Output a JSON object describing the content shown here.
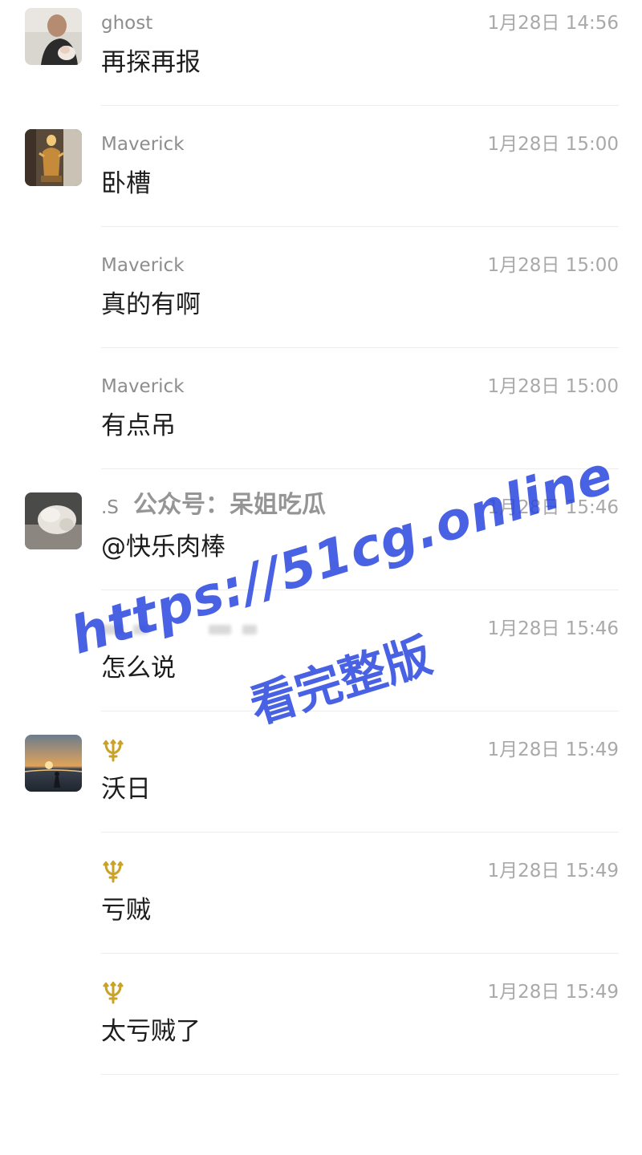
{
  "messages": [
    {
      "sender": "ghost",
      "time": "1月28日 14:56",
      "text": "再探再报",
      "avatar": "avatar-man-with-baby"
    },
    {
      "sender": "Maverick",
      "time": "1月28日 15:00",
      "text": "卧槽",
      "avatar": "avatar-golden-figure"
    },
    {
      "sender": "Maverick",
      "time": "1月28日 15:00",
      "text": "真的有啊"
    },
    {
      "sender": "Maverick",
      "time": "1月28日 15:00",
      "text": "有点吊"
    },
    {
      "sender": ".S",
      "time": "1月28日 15:46",
      "text": "@快乐肉棒",
      "avatar": "avatar-fluffy-animal"
    },
    {
      "sender": "",
      "time": "1月28日 15:46",
      "text": "怎么说"
    },
    {
      "sender": "",
      "sender_icon": "trident-icon",
      "time": "1月28日 15:49",
      "text": "沃日",
      "avatar": "avatar-sunset-beach"
    },
    {
      "sender": "",
      "sender_icon": "trident-icon",
      "time": "1月28日 15:49",
      "text": "亏贼"
    },
    {
      "sender": "",
      "sender_icon": "trident-icon",
      "time": "1月28日 15:49",
      "text": "太亏贼了"
    }
  ],
  "watermark": {
    "account": "公众号：呆姐吃瓜",
    "url": "https://51cg.online",
    "subtitle": "看完整版"
  },
  "colors": {
    "name": "#8d8d8d",
    "time": "#a9a9a9",
    "text": "#1d1d1d",
    "watermark_blue": "#2a47e0",
    "trident_gold": "#c9a227"
  }
}
